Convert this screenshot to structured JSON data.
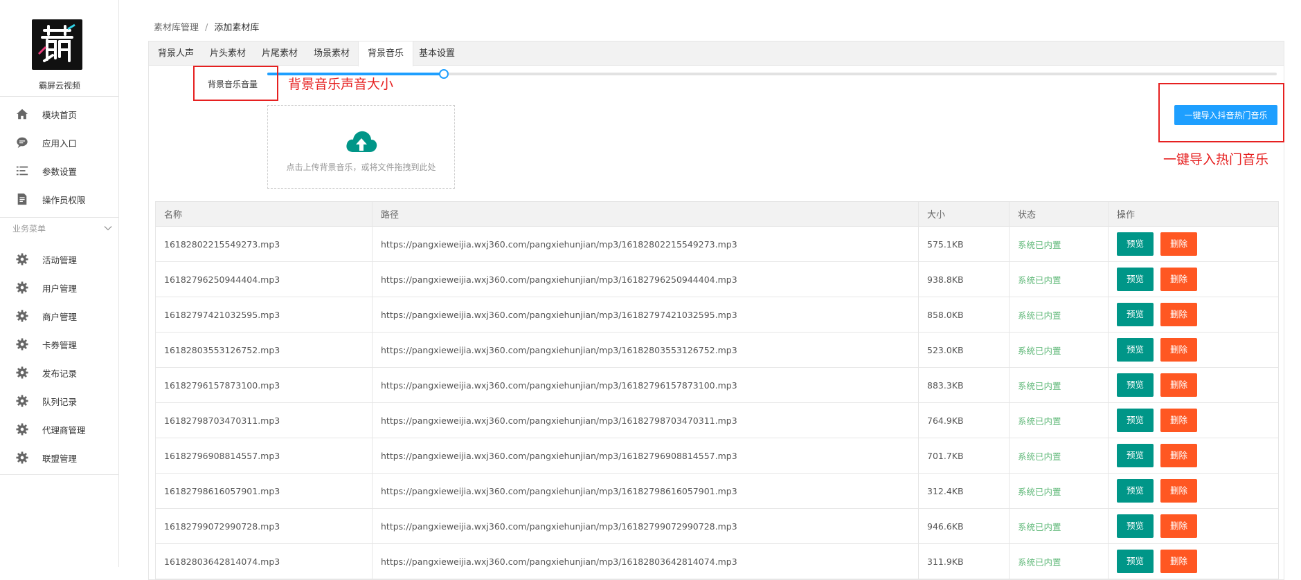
{
  "sidebar": {
    "brand": "霸屏云视频",
    "top_items": [
      {
        "label": "模块首页",
        "icon": "home-icon"
      },
      {
        "label": "应用入口",
        "icon": "chat-bubble-icon"
      },
      {
        "label": "参数设置",
        "icon": "list-icon"
      },
      {
        "label": "操作员权限",
        "icon": "document-edit-icon"
      }
    ],
    "group_label": "业务菜单",
    "group_items": [
      {
        "label": "活动管理",
        "icon": "gear-icon"
      },
      {
        "label": "用户管理",
        "icon": "gear-icon"
      },
      {
        "label": "商户管理",
        "icon": "gear-icon"
      },
      {
        "label": "卡券管理",
        "icon": "gear-icon"
      },
      {
        "label": "发布记录",
        "icon": "gear-icon"
      },
      {
        "label": "队列记录",
        "icon": "gear-icon"
      },
      {
        "label": "代理商管理",
        "icon": "gear-icon"
      },
      {
        "label": "联盟管理",
        "icon": "gear-icon"
      }
    ]
  },
  "breadcrumb": {
    "parent": "素材库管理",
    "separator": "/",
    "current": "添加素材库"
  },
  "tabs": [
    {
      "label": "背景人声",
      "active": false
    },
    {
      "label": "片头素材",
      "active": false
    },
    {
      "label": "片尾素材",
      "active": false
    },
    {
      "label": "场景素材",
      "active": false
    },
    {
      "label": "背景音乐",
      "active": true
    },
    {
      "label": "基本设置",
      "active": false
    }
  ],
  "volume": {
    "label": "背景音乐音量",
    "level_fraction": 0.175
  },
  "upload": {
    "text": "点击上传背景音乐，或将文件拖拽到此处",
    "icon": "cloud-upload-icon"
  },
  "import_button": {
    "label": "一键导入抖音热门音乐"
  },
  "annotations": {
    "volume_note": "背景音乐声音大小",
    "import_note": "一键导入热门音乐"
  },
  "table": {
    "headers": [
      "名称",
      "路径",
      "大小",
      "状态",
      "操作"
    ],
    "preview_label": "预览",
    "delete_label": "删除",
    "rows": [
      {
        "name": "16182802215549273.mp3",
        "path": "https://pangxieweijia.wxj360.com/pangxiehunjian/mp3/16182802215549273.mp3",
        "size": "575.1KB",
        "status": "系统已内置"
      },
      {
        "name": "16182796250944404.mp3",
        "path": "https://pangxieweijia.wxj360.com/pangxiehunjian/mp3/16182796250944404.mp3",
        "size": "938.8KB",
        "status": "系统已内置"
      },
      {
        "name": "16182797421032595.mp3",
        "path": "https://pangxieweijia.wxj360.com/pangxiehunjian/mp3/16182797421032595.mp3",
        "size": "858.0KB",
        "status": "系统已内置"
      },
      {
        "name": "16182803553126752.mp3",
        "path": "https://pangxieweijia.wxj360.com/pangxiehunjian/mp3/16182803553126752.mp3",
        "size": "523.0KB",
        "status": "系统已内置"
      },
      {
        "name": "16182796157873100.mp3",
        "path": "https://pangxieweijia.wxj360.com/pangxiehunjian/mp3/16182796157873100.mp3",
        "size": "883.3KB",
        "status": "系统已内置"
      },
      {
        "name": "16182798703470311.mp3",
        "path": "https://pangxieweijia.wxj360.com/pangxiehunjian/mp3/16182798703470311.mp3",
        "size": "764.9KB",
        "status": "系统已内置"
      },
      {
        "name": "16182796908814557.mp3",
        "path": "https://pangxieweijia.wxj360.com/pangxiehunjian/mp3/16182796908814557.mp3",
        "size": "701.7KB",
        "status": "系统已内置"
      },
      {
        "name": "16182798616057901.mp3",
        "path": "https://pangxieweijia.wxj360.com/pangxiehunjian/mp3/16182798616057901.mp3",
        "size": "312.4KB",
        "status": "系统已内置"
      },
      {
        "name": "16182799072990728.mp3",
        "path": "https://pangxieweijia.wxj360.com/pangxiehunjian/mp3/16182799072990728.mp3",
        "size": "946.6KB",
        "status": "系统已内置"
      },
      {
        "name": "16182803642814074.mp3",
        "path": "https://pangxieweijia.wxj360.com/pangxiehunjian/mp3/16182803642814074.mp3",
        "size": "311.9KB",
        "status": "系统已内置"
      }
    ]
  },
  "colors": {
    "accent": "#1e9fff",
    "preview": "#009688",
    "delete": "#ff5722",
    "status": "#5FB878",
    "annotation": "#e62020"
  }
}
